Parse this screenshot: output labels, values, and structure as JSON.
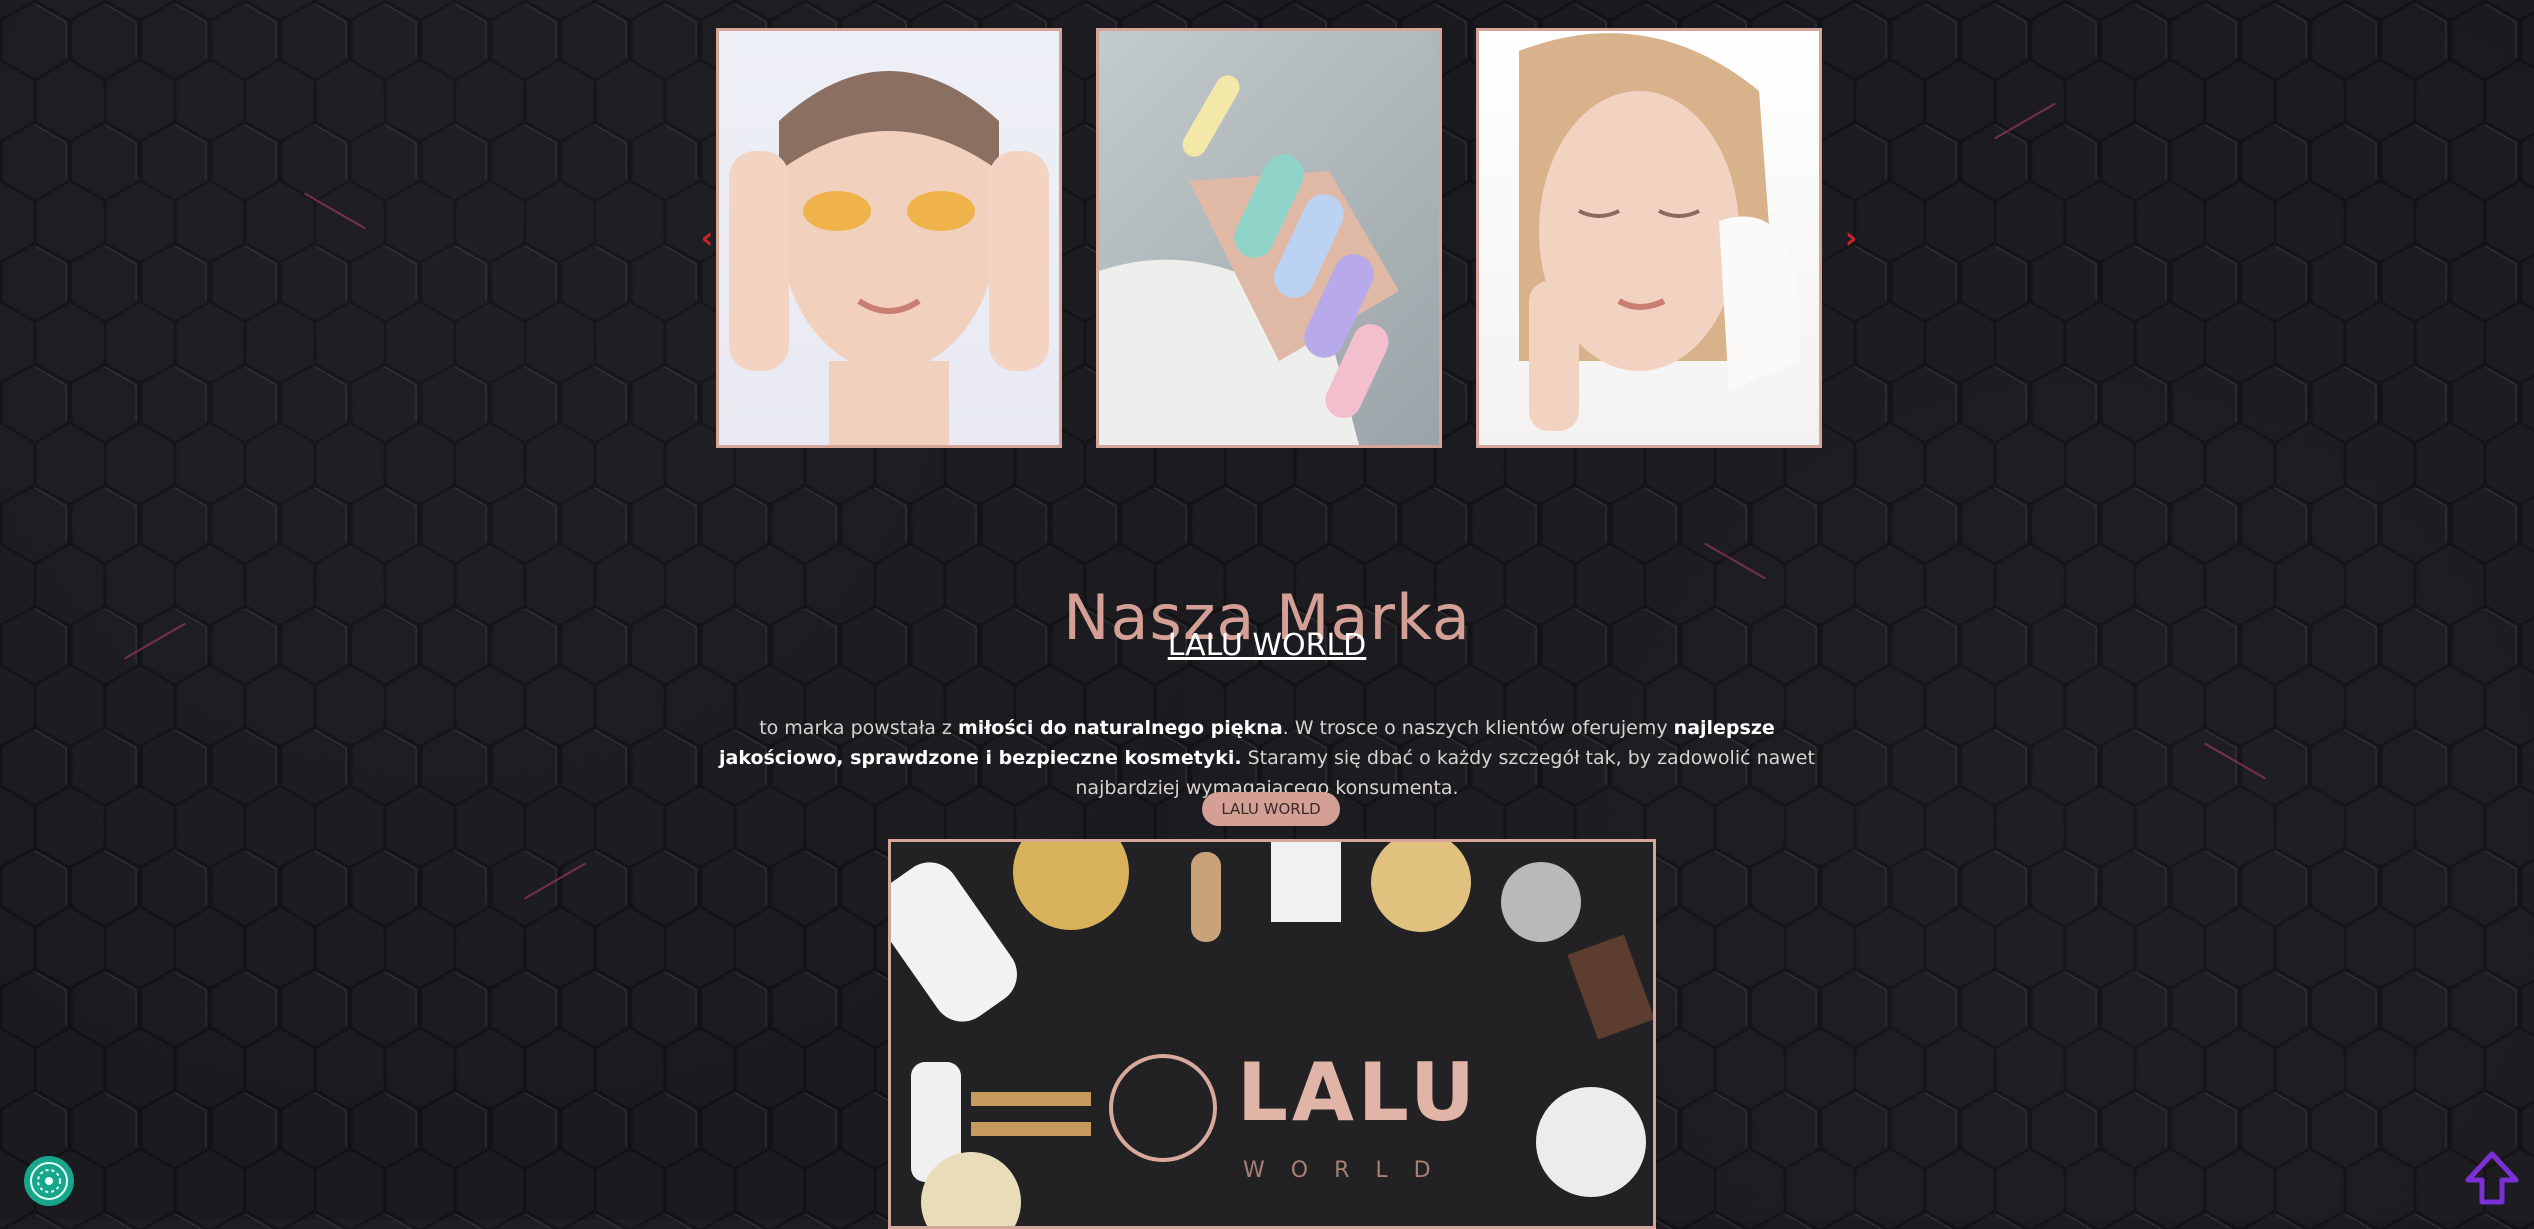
{
  "carousel": {
    "prev_label": "‹",
    "next_label": "›",
    "slides": [
      {
        "alt": "Kobieta z złotymi płatkami pod oczami"
      },
      {
        "alt": "Pastelowe paznokcie w kropki"
      },
      {
        "alt": "Kobieta z ręcznikiem przy twarzy"
      }
    ]
  },
  "section": {
    "title": "Nasza Marka",
    "brand_link": "LALU WORLD",
    "desc_part1": "to marka powstała z ",
    "desc_bold1": "miłości do naturalnego piękna",
    "desc_part2": ". W trosce o naszych klientów oferujemy ",
    "desc_bold2": "najlepsze jakościowo, sprawdzone i bezpieczne kosmetyki.",
    "desc_part3": " Staramy się dbać o każdy szczegół tak, by zadowolić nawet najbardziej wymagającego konsumenta.",
    "button_label": "LALU WORLD"
  },
  "banner": {
    "logo_word": "LALU",
    "logo_sub": "WORLD"
  },
  "colors": {
    "accent": "#d4a096",
    "arrow": "#d3202a",
    "chat": "#17a68c",
    "scroll_top": "#7b2fd6"
  },
  "icons": {
    "prev": "chevron-left-icon",
    "next": "chevron-right-icon",
    "chat": "chat-icon",
    "scroll_top": "arrow-up-icon"
  }
}
